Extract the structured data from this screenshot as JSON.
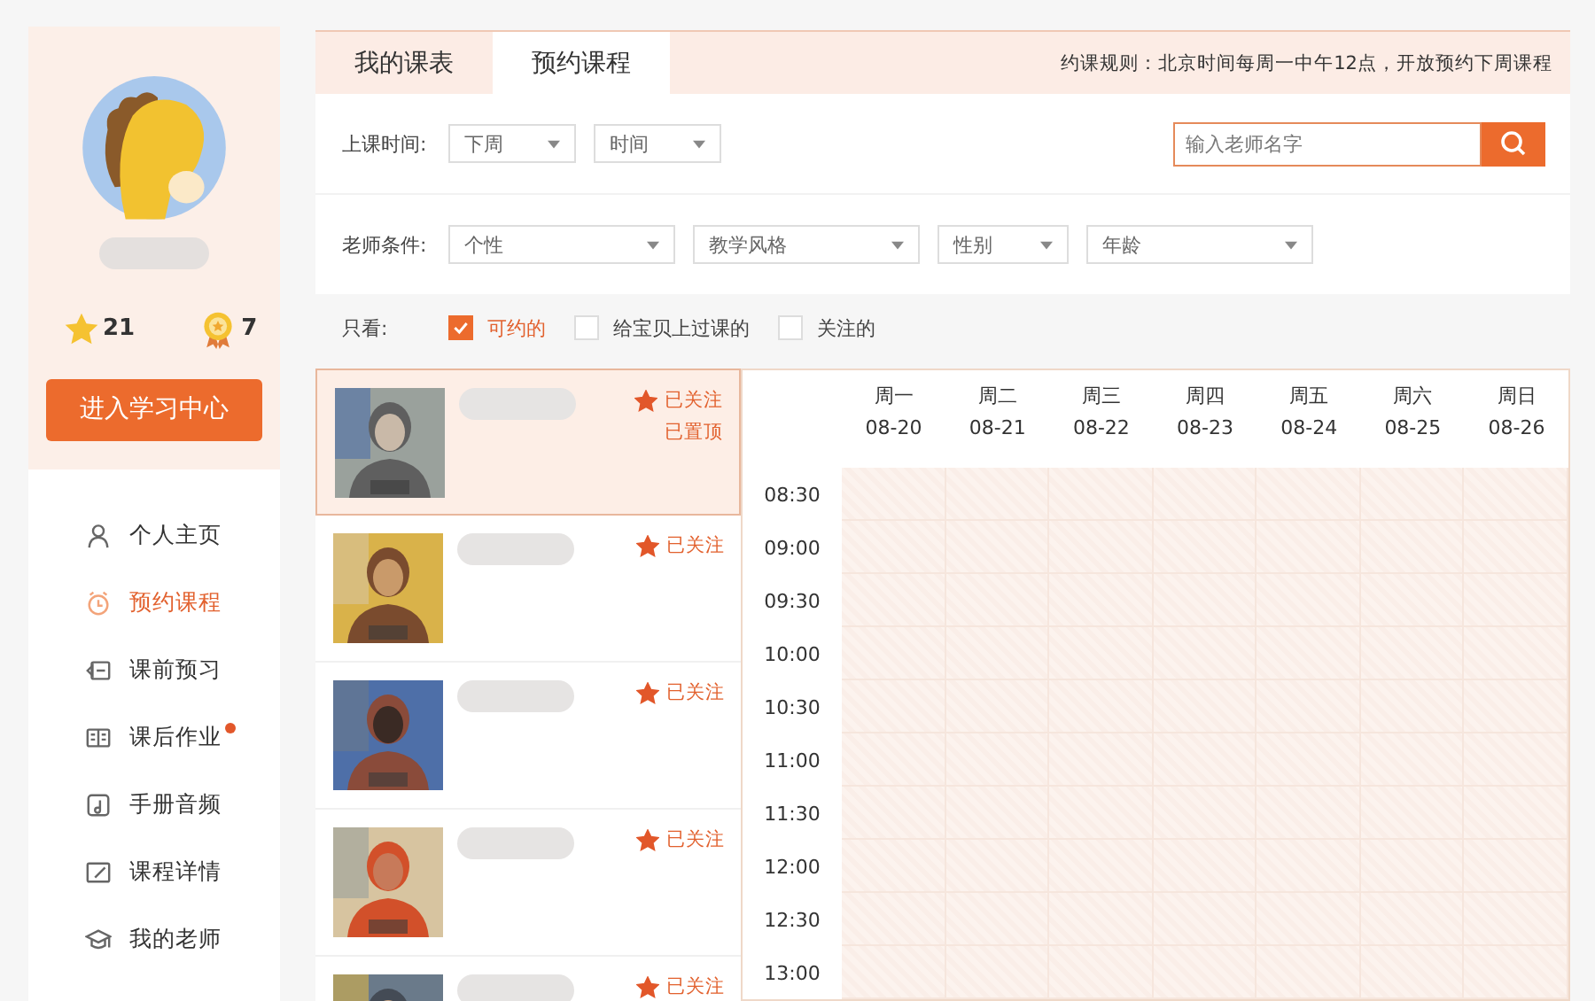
{
  "profile": {
    "stars": "21",
    "medals": "7",
    "button": "进入学习中心"
  },
  "menu": [
    {
      "label": "个人主页",
      "selected": false,
      "dot": false
    },
    {
      "label": "预约课程",
      "selected": true,
      "dot": false
    },
    {
      "label": "课前预习",
      "selected": false,
      "dot": false
    },
    {
      "label": "课后作业",
      "selected": false,
      "dot": true
    },
    {
      "label": "手册音频",
      "selected": false,
      "dot": false
    },
    {
      "label": "课程详情",
      "selected": false,
      "dot": false
    },
    {
      "label": "我的老师",
      "selected": false,
      "dot": false
    }
  ],
  "tabs": [
    {
      "label": "我的课表",
      "selected": false
    },
    {
      "label": "预约课程",
      "selected": true
    }
  ],
  "rule": "约课规则：北京时间每周一中午12点，开放预约下周课程",
  "filters": [
    {
      "label": "上课时间:",
      "selects": [
        "下周",
        "时间"
      ]
    },
    {
      "label": "老师条件:",
      "selects": [
        "个性",
        "教学风格",
        "性别",
        "年龄"
      ]
    }
  ],
  "search": {
    "placeholder": "输入老师名字"
  },
  "only_view": {
    "label": "只看:",
    "options": [
      {
        "label": "可约的",
        "checked": true
      },
      {
        "label": "给宝贝上过课的",
        "checked": false
      },
      {
        "label": "关注的",
        "checked": false
      }
    ]
  },
  "teachers": [
    {
      "selected": true,
      "followed": true,
      "follow_label": "已关注",
      "pin_label": "已置顶"
    },
    {
      "selected": false,
      "followed": true,
      "follow_label": "已关注"
    },
    {
      "selected": false,
      "followed": true,
      "follow_label": "已关注"
    },
    {
      "selected": false,
      "followed": true,
      "follow_label": "已关注"
    },
    {
      "selected": false,
      "followed": true,
      "follow_label": "已关注"
    }
  ],
  "calendar": {
    "days": [
      {
        "day": "周一",
        "date": "08-20"
      },
      {
        "day": "周二",
        "date": "08-21"
      },
      {
        "day": "周三",
        "date": "08-22"
      },
      {
        "day": "周四",
        "date": "08-23"
      },
      {
        "day": "周五",
        "date": "08-24"
      },
      {
        "day": "周六",
        "date": "08-25"
      },
      {
        "day": "周日",
        "date": "08-26"
      }
    ],
    "times": [
      "08:30",
      "09:00",
      "09:30",
      "10:00",
      "10:30",
      "11:00",
      "11:30",
      "12:00",
      "12:30",
      "13:00"
    ]
  }
}
